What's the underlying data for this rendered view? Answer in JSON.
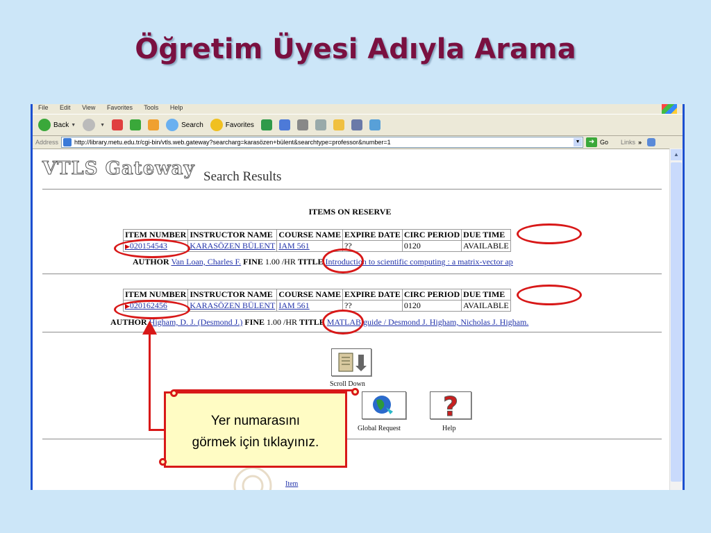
{
  "slide": {
    "title": "Öğretim Üyesi Adıyla Arama",
    "callout": [
      "Yer numarasını",
      "görmek için tıklayınız."
    ]
  },
  "browser": {
    "menu": [
      "File",
      "Edit",
      "View",
      "Favorites",
      "Tools",
      "Help"
    ],
    "toolbar": {
      "back": "Back",
      "search": "Search",
      "favorites": "Favorites"
    },
    "address": {
      "label": "Address",
      "url": "http://library.metu.edu.tr/cgi-bin/vtls.web.gateway?searcharg=karasözen+bülent&searchtype=professor&number=1",
      "go": "Go",
      "links": "Links"
    }
  },
  "page": {
    "logo": "VTLS Gateway",
    "heading": "Search Results",
    "section": "ITEMS ON RESERVE",
    "columns": [
      "ITEM NUMBER",
      "INSTRUCTOR NAME",
      "COURSE NAME",
      "EXPIRE DATE",
      "CIRC PERIOD",
      "DUE TIME"
    ],
    "items": [
      {
        "item_number": "020154543",
        "instructor": "KARASÖZEN BÜLENT",
        "course": "IAM 561",
        "expire": "??",
        "circ": "0120",
        "due": "AVAILABLE",
        "author_label": "AUTHOR",
        "author": "Van Loan, Charles F.",
        "fine_label": "FINE",
        "fine": "1.00 /HR",
        "title_label": "TITLE",
        "title": "Introduction to scientific computing : a matrix-vector ap"
      },
      {
        "item_number": "020162456",
        "instructor": "KARASÖZEN BÜLENT",
        "course": "IAM 561",
        "expire": "??",
        "circ": "0120",
        "due": "AVAILABLE",
        "author_label": "AUTHOR",
        "author": "Higham, D. J. (Desmond J.)",
        "fine_label": "FINE",
        "fine": "1.00 /HR",
        "title_label": "TITLE",
        "title": "MATLAB guide / Desmond J. Higham, Nicholas J. Higham."
      }
    ],
    "buttons": {
      "scroll_down": "Scroll Down",
      "global_request": "Global Request",
      "help": "Help",
      "item": "Item"
    }
  },
  "colors": {
    "slide_bg": "#cce6f8",
    "title": "#7a1040",
    "highlight": "#d81818",
    "callout_bg": "#fffcc4",
    "link": "#2233aa"
  }
}
